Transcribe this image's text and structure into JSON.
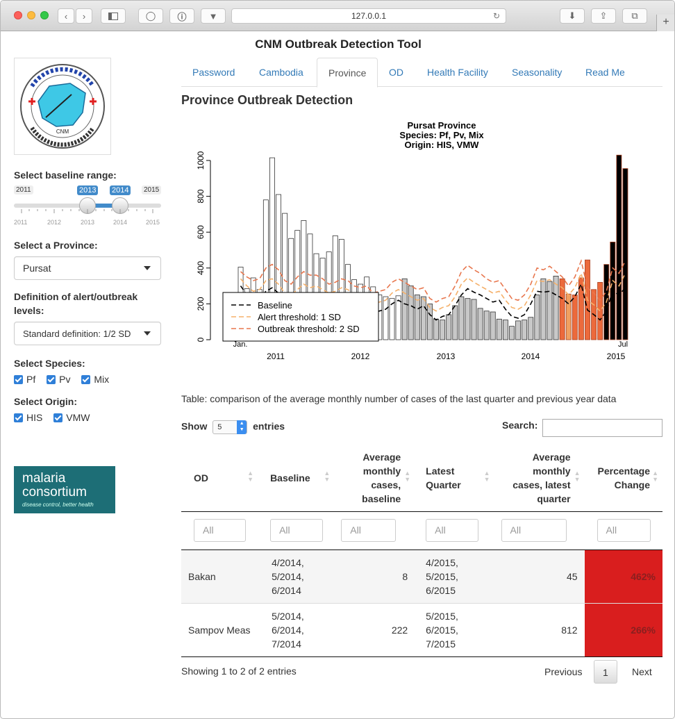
{
  "browser": {
    "url": "127.0.0.1"
  },
  "app": {
    "title": "CNM Outbreak Detection Tool"
  },
  "tabs": [
    {
      "label": "Password"
    },
    {
      "label": "Cambodia"
    },
    {
      "label": "Province"
    },
    {
      "label": "OD"
    },
    {
      "label": "Health Facility"
    },
    {
      "label": "Seasonality"
    },
    {
      "label": "Read Me"
    }
  ],
  "active_tab": "Province",
  "sidebar": {
    "logo_text": "CNM",
    "baseline_label": "Select baseline range:",
    "slider": {
      "min": "2011",
      "max": "2015",
      "from": "2013",
      "to": "2014",
      "ticks": [
        "2011",
        "2012",
        "2013",
        "2014",
        "2015"
      ]
    },
    "province_label": "Select a Province:",
    "province_value": "Pursat",
    "definition_label": "Definition of alert/outbreak levels:",
    "definition_value": "Standard definition: 1/2 SD",
    "species_label": "Select Species:",
    "species": [
      "Pf",
      "Pv",
      "Mix"
    ],
    "origin_label": "Select Origin:",
    "origin": [
      "HIS",
      "VMW"
    ],
    "brand": {
      "line1": "malaria",
      "line2": "consortium",
      "tagline": "disease control, better health"
    }
  },
  "main": {
    "heading": "Province Outbreak Detection",
    "caption": "Table: comparison of the average monthly number of cases of the last quarter and previous year data",
    "show_label": "Show",
    "entries_value": "5",
    "entries_label": "entries",
    "search_label": "Search:",
    "filter_placeholder": "All",
    "columns": [
      {
        "label": "OD"
      },
      {
        "label": "Baseline"
      },
      {
        "label": "Average monthly cases, baseline"
      },
      {
        "label": "Latest Quarter"
      },
      {
        "label": "Average monthly cases, latest quarter"
      },
      {
        "label": "Percentage Change"
      }
    ],
    "rows": [
      {
        "od": "Bakan",
        "baseline": [
          "4/2014,",
          "5/2014,",
          "6/2014"
        ],
        "avg_base": "8",
        "latest": [
          "4/2015,",
          "5/2015,",
          "6/2015"
        ],
        "avg_latest": "45",
        "change": "462%"
      },
      {
        "od": "Sampov Meas",
        "baseline": [
          "5/2014,",
          "6/2014,",
          "7/2014"
        ],
        "avg_base": "222",
        "latest": [
          "5/2015,",
          "6/2015,",
          "7/2015"
        ],
        "avg_latest": "812",
        "change": "266%"
      }
    ],
    "info": "Showing 1 to 2 of 2 entries",
    "pager": {
      "prev": "Previous",
      "page": "1",
      "next": "Next"
    }
  },
  "chart_data": {
    "type": "bar",
    "title": [
      "Pursat Province",
      "Species:  Pf, Pv, Mix",
      "Origin:  HIS, VMW"
    ],
    "ylim": [
      0,
      1050
    ],
    "yticks": [
      "0",
      "200",
      "400",
      "600",
      "800",
      "1000"
    ],
    "x_year_ticks": [
      "2011",
      "2012",
      "2013",
      "2014",
      "2015"
    ],
    "x_month_ticks": [
      "Jan.",
      "Jul"
    ],
    "legend": {
      "position": "bottom-left",
      "entries": [
        "Baseline",
        "Alert threshold:  1 SD",
        "Outbreak threshold:  2 SD"
      ]
    },
    "colors": {
      "history": "#ffffff",
      "baseline_period": "#c8c8c8",
      "latest_alert": "#f0a060",
      "latest_outbreak": "#ec6a3c",
      "baseline_line": "#000000",
      "alert_line": "#f5b06a",
      "outbreak_line": "#e8764d"
    },
    "bar_groups": [
      "history",
      "history",
      "history",
      "history",
      "history",
      "history",
      "history",
      "history",
      "history",
      "history",
      "history",
      "history",
      "history",
      "history",
      "history",
      "history",
      "history",
      "history",
      "history",
      "history",
      "history",
      "history",
      "history",
      "history",
      "history",
      "history",
      "baseline_period",
      "baseline_period",
      "baseline_period",
      "baseline_period",
      "baseline_period",
      "baseline_period",
      "baseline_period",
      "baseline_period",
      "baseline_period",
      "baseline_period",
      "baseline_period",
      "baseline_period",
      "baseline_period",
      "baseline_period",
      "baseline_period",
      "baseline_period",
      "baseline_period",
      "baseline_period",
      "baseline_period",
      "baseline_period",
      "baseline_period",
      "baseline_period",
      "baseline_period",
      "baseline_period",
      "baseline_period",
      "latest_outbreak",
      "latest_alert",
      "latest_outbreak",
      "latest_outbreak",
      "latest_outbreak",
      "latest_outbreak",
      "latest_outbreak"
    ],
    "values": [
      405,
      285,
      345,
      280,
      780,
      1015,
      810,
      705,
      565,
      610,
      665,
      590,
      480,
      455,
      490,
      580,
      560,
      420,
      335,
      310,
      350,
      295,
      250,
      240,
      230,
      245,
      340,
      300,
      250,
      240,
      200,
      115,
      110,
      140,
      190,
      240,
      230,
      225,
      175,
      160,
      155,
      115,
      110,
      75,
      105,
      110,
      125,
      250,
      340,
      325,
      355,
      340,
      255,
      250,
      345,
      445,
      280,
      320,
      420,
      545,
      1030,
      955
    ],
    "baseline": [
      300,
      250,
      220,
      230,
      270,
      290,
      260,
      210,
      200,
      230,
      260,
      240,
      250,
      220,
      210,
      220,
      240,
      230,
      200,
      180,
      175,
      150,
      160,
      170,
      200,
      220,
      200,
      190,
      170,
      190,
      140,
      110,
      130,
      140,
      190,
      250,
      285,
      265,
      250,
      230,
      210,
      220,
      170,
      130,
      120,
      140,
      200,
      270,
      265,
      270,
      250,
      230,
      200,
      240,
      310,
      165,
      140,
      110,
      160,
      270,
      250,
      290
    ],
    "alert": [
      340,
      300,
      270,
      280,
      330,
      340,
      310,
      260,
      250,
      280,
      310,
      290,
      300,
      280,
      260,
      270,
      290,
      280,
      250,
      230,
      240,
      200,
      210,
      220,
      260,
      280,
      260,
      240,
      220,
      230,
      180,
      160,
      180,
      190,
      240,
      310,
      345,
      320,
      300,
      280,
      260,
      270,
      220,
      180,
      170,
      190,
      250,
      330,
      325,
      335,
      310,
      290,
      250,
      290,
      370,
      220,
      195,
      160,
      210,
      330,
      300,
      370
    ],
    "outbreak": [
      380,
      350,
      330,
      340,
      400,
      420,
      390,
      330,
      310,
      350,
      380,
      360,
      360,
      340,
      310,
      320,
      340,
      330,
      300,
      290,
      300,
      260,
      270,
      280,
      320,
      340,
      320,
      300,
      280,
      290,
      230,
      210,
      230,
      240,
      300,
      380,
      415,
      390,
      370,
      340,
      320,
      330,
      280,
      230,
      220,
      250,
      310,
      400,
      390,
      410,
      380,
      350,
      300,
      350,
      440,
      290,
      260,
      220,
      270,
      400,
      370,
      440
    ]
  }
}
